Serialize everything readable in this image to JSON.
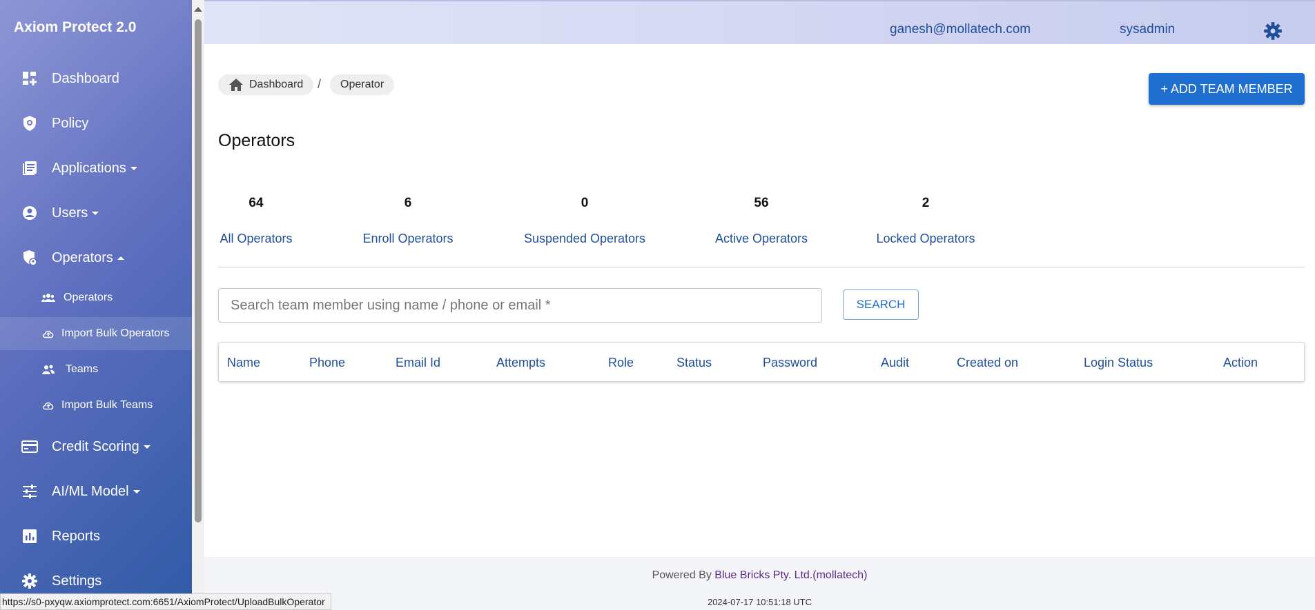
{
  "app": {
    "brand": "Axiom Protect 2.0"
  },
  "sidebar": {
    "items": [
      {
        "label": "Dashboard",
        "icon": "dashboard-icon"
      },
      {
        "label": "Policy",
        "icon": "policy-shield-icon"
      },
      {
        "label": "Applications",
        "icon": "applications-icon",
        "expandable": true
      },
      {
        "label": "Users",
        "icon": "user-circle-icon",
        "expandable": true
      },
      {
        "label": "Operators",
        "icon": "operator-shield-icon",
        "expandable": true,
        "expanded": true
      },
      {
        "label": "Credit Scoring",
        "icon": "credit-card-icon",
        "expandable": true
      },
      {
        "label": "AI/ML Model",
        "icon": "tune-sliders-icon",
        "expandable": true
      },
      {
        "label": "Reports",
        "icon": "bar-chart-icon"
      },
      {
        "label": "Settings",
        "icon": "gear-icon"
      }
    ],
    "operator_subitems": [
      {
        "label": "Operators",
        "icon": "group-icon"
      },
      {
        "label": "Import Bulk Operators",
        "icon": "cloud-upload-icon",
        "active": true
      },
      {
        "label": "Teams",
        "icon": "team-icon"
      },
      {
        "label": "Import Bulk Teams",
        "icon": "cloud-upload-icon"
      }
    ]
  },
  "topbar": {
    "email": "ganesh@mollatech.com",
    "user": "sysadmin",
    "settings_icon": "gear-icon"
  },
  "breadcrumb": {
    "home": "Dashboard",
    "separator": "/",
    "current": "Operator"
  },
  "add_button": "+ ADD TEAM MEMBER",
  "page_title": "Operators",
  "stats": [
    {
      "count": "64",
      "label": "All Operators"
    },
    {
      "count": "6",
      "label": "Enroll Operators"
    },
    {
      "count": "0",
      "label": "Suspended Operators"
    },
    {
      "count": "56",
      "label": "Active Operators"
    },
    {
      "count": "2",
      "label": "Locked Operators"
    }
  ],
  "search": {
    "placeholder": "Search team member using name / phone or email *",
    "value": "",
    "button": "SEARCH"
  },
  "table": {
    "columns": [
      "Name",
      "Phone",
      "Email Id",
      "Attempts",
      "Role",
      "Status",
      "Password",
      "Audit",
      "Created on",
      "Login Status",
      "Action"
    ],
    "rows": []
  },
  "footer": {
    "powered_by": "Powered By",
    "company": "Blue Bricks Pty. Ltd.(mollatech)",
    "timestamp": "2024-07-17 10:51:18 UTC"
  },
  "statusbar": {
    "url": "https://s0-pxyqw.axiomprotect.com:6651/AxiomProtect/UploadBulkOperator"
  },
  "colors": {
    "accent": "#1f6fd1",
    "link": "#1f4e9c",
    "footer_company": "#5b2a8a"
  }
}
